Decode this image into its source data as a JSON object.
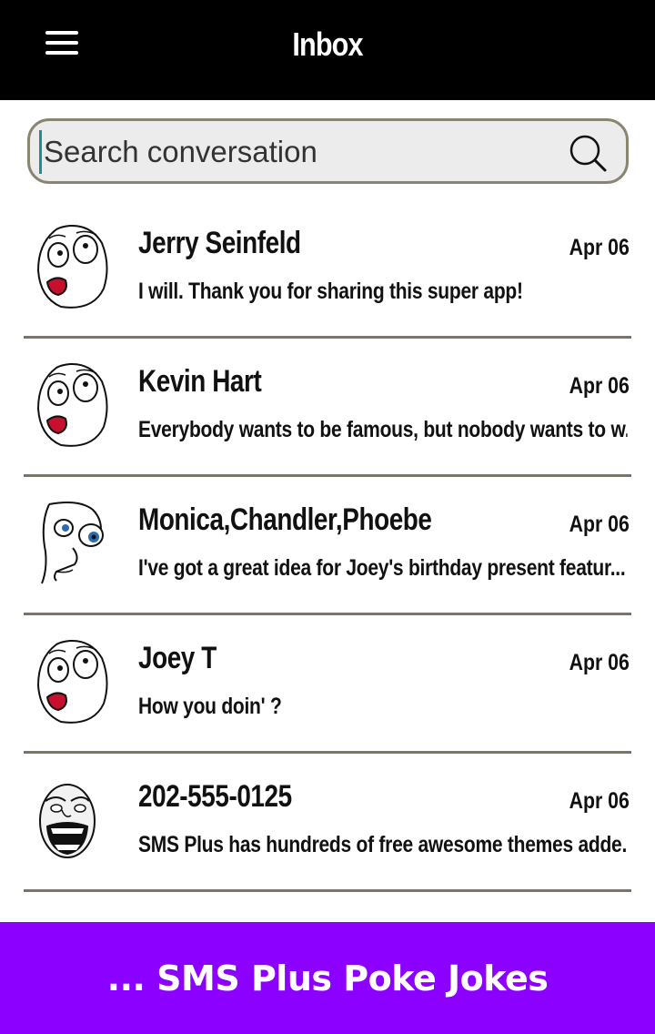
{
  "header": {
    "title": "Inbox",
    "menu_icon": "hamburger-menu-icon"
  },
  "search": {
    "placeholder": "Search conversation",
    "value": "",
    "icon": "search-icon"
  },
  "conversations": [
    {
      "name": "Jerry Seinfeld",
      "date": "Apr 06",
      "preview": "I will. Thank you for sharing this super app!",
      "avatar": "rage-face-surprised-icon"
    },
    {
      "name": "Kevin Hart",
      "date": "Apr 06",
      "preview": "Everybody wants to be famous, but nobody wants to w...",
      "avatar": "rage-face-surprised-icon"
    },
    {
      "name": "Monica,Chandler,Phoebe",
      "date": "Apr 06",
      "preview": "I've got a great idea for Joey's birthday present featur...",
      "avatar": "rage-face-thinking-icon"
    },
    {
      "name": "Joey T",
      "date": "Apr 06",
      "preview": "How you doin' ?",
      "avatar": "rage-face-surprised-icon"
    },
    {
      "name": "202-555-0125",
      "date": "Apr 06",
      "preview": "SMS Plus has hundreds of free awesome themes adde...",
      "avatar": "forever-alone-face-icon"
    }
  ],
  "banner": {
    "text": "... SMS Plus Poke Jokes",
    "color": "#8b00ff"
  },
  "colors": {
    "topbar": "#000000",
    "search_bg": "#ececec",
    "search_border": "#8a8570",
    "divider": "#7a7565"
  }
}
